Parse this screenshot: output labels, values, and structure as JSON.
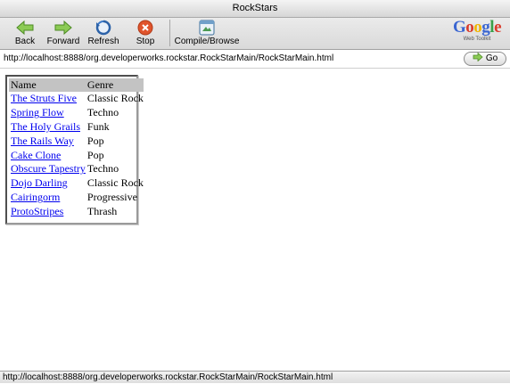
{
  "window": {
    "title": "RockStars"
  },
  "toolbar": {
    "buttons": [
      {
        "label": "Back",
        "icon": "back-arrow-icon"
      },
      {
        "label": "Forward",
        "icon": "forward-arrow-icon"
      },
      {
        "label": "Refresh",
        "icon": "refresh-icon"
      },
      {
        "label": "Stop",
        "icon": "stop-icon"
      },
      {
        "label": "Compile/Browse",
        "icon": "compile-browse-icon"
      }
    ],
    "logo": {
      "text": "Google",
      "subtext": "Web Toolkit"
    }
  },
  "address_bar": {
    "url": "http://localhost:8888/org.developerworks.rockstar.RockStarMain/RockStarMain.html",
    "go_label": "Go"
  },
  "grid": {
    "headers": [
      "Name",
      "Genre"
    ],
    "rows": [
      {
        "name": "The Struts Five",
        "genre": "Classic Rock"
      },
      {
        "name": "Spring Flow",
        "genre": "Techno"
      },
      {
        "name": "The Holy Grails",
        "genre": "Funk"
      },
      {
        "name": "The Rails Way",
        "genre": "Pop"
      },
      {
        "name": "Cake Clone",
        "genre": "Pop"
      },
      {
        "name": "Obscure Tapestry",
        "genre": "Techno"
      },
      {
        "name": "Dojo Darling",
        "genre": "Classic Rock"
      },
      {
        "name": "Cairingorm",
        "genre": "Progressive"
      },
      {
        "name": "ProtoStripes",
        "genre": "Thrash"
      }
    ]
  },
  "status_bar": {
    "text": "http://localhost:8888/org.developerworks.rockstar.RockStarMain/RockStarMain.html"
  },
  "colors": {
    "link": "#0000ee",
    "header_bg": "#c3c3c3",
    "green_arrow": "#6fb13c",
    "stop_red": "#e0542c",
    "refresh_blue": "#3a78c8"
  }
}
